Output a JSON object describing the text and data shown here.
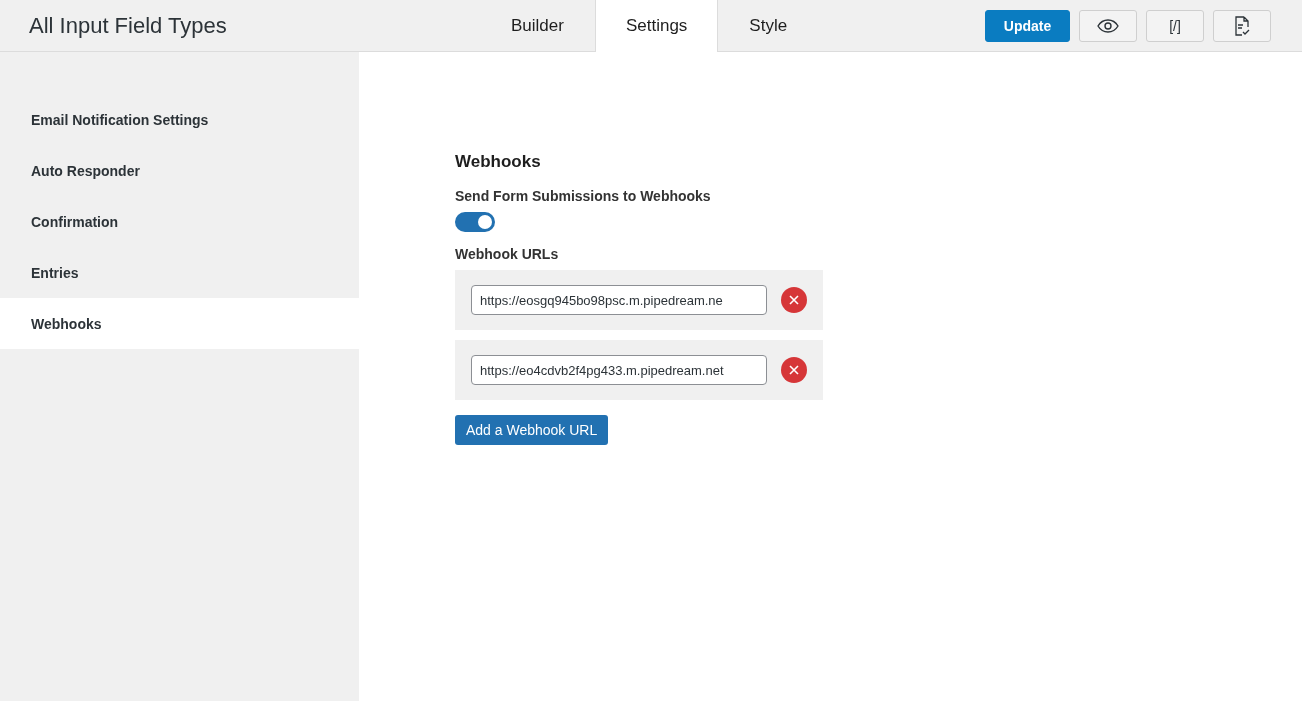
{
  "header": {
    "title": "All Input Field Types",
    "tabs": [
      {
        "label": "Builder",
        "selected": false
      },
      {
        "label": "Settings",
        "selected": true
      },
      {
        "label": "Style",
        "selected": false
      }
    ],
    "actions": [
      {
        "kind": "primary",
        "label": "Update"
      },
      {
        "kind": "preview"
      },
      {
        "kind": "shortcode",
        "label": "[/]"
      },
      {
        "kind": "entries"
      }
    ]
  },
  "sidebar": {
    "items": [
      {
        "label": "Email Notification Settings",
        "selected": false
      },
      {
        "label": "Auto Responder",
        "selected": false
      },
      {
        "label": "Confirmation",
        "selected": false
      },
      {
        "label": "Entries",
        "selected": false
      },
      {
        "label": "Webhooks",
        "selected": true
      }
    ]
  },
  "content": {
    "heading": "Webhooks",
    "toggle_label": "Send Form Submissions to Webhooks",
    "toggle_on": true,
    "urls_label": "Webhook URLs",
    "urls": [
      {
        "value": "https://eosgq945bo98psc.m.pipedream.ne"
      },
      {
        "value": "https://eo4cdvb2f4pg433.m.pipedream.net"
      }
    ],
    "add_button": "Add a Webhook URL"
  }
}
